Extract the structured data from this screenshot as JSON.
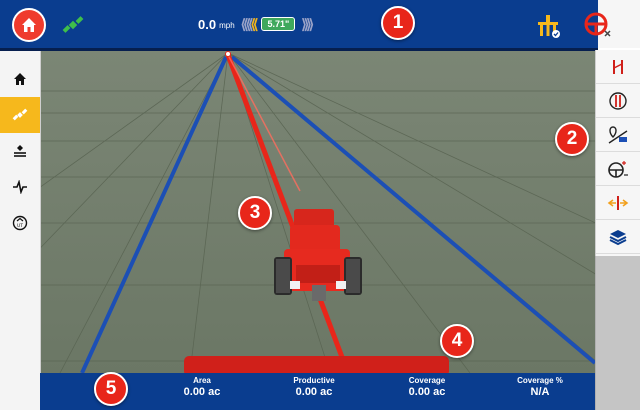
{
  "colors": {
    "bar_blue": "#0a3d8f",
    "accent_red": "#ef3b2d",
    "accent_yellow": "#f6b81c",
    "guidance_green": "#3fa85c"
  },
  "header": {
    "home_icon": "home-icon",
    "gps_icon": "satellite-icon",
    "speed_value": "0.0",
    "speed_unit": "mph",
    "offset_value": "5.71\"",
    "implement_icon": "implement-status-icon",
    "steering_icon": "steering-wheel-disabled-icon"
  },
  "markers": [
    "1",
    "2",
    "3",
    "4",
    "5"
  ],
  "sidebar": {
    "items": [
      {
        "icon": "home-icon",
        "active": false
      },
      {
        "icon": "guidance-icon",
        "active": true
      },
      {
        "icon": "field-layers-icon",
        "active": false
      },
      {
        "icon": "diagnostics-icon",
        "active": false
      },
      {
        "icon": "isobus-ut-icon",
        "active": false
      }
    ]
  },
  "toolpanel": {
    "items": [
      "guidance-lines-icon",
      "shift-line-icon",
      "mark-point-icon",
      "steering-sensitivity-icon",
      "nudge-icon",
      "layers-icon"
    ]
  },
  "stats": {
    "area": {
      "label": "Area",
      "value": "0.00 ac"
    },
    "productive": {
      "label": "Productive",
      "value": "0.00 ac"
    },
    "coverage": {
      "label": "Coverage",
      "value": "0.00 ac"
    },
    "coverage_pct": {
      "label": "Coverage %",
      "value": "N/A"
    }
  }
}
